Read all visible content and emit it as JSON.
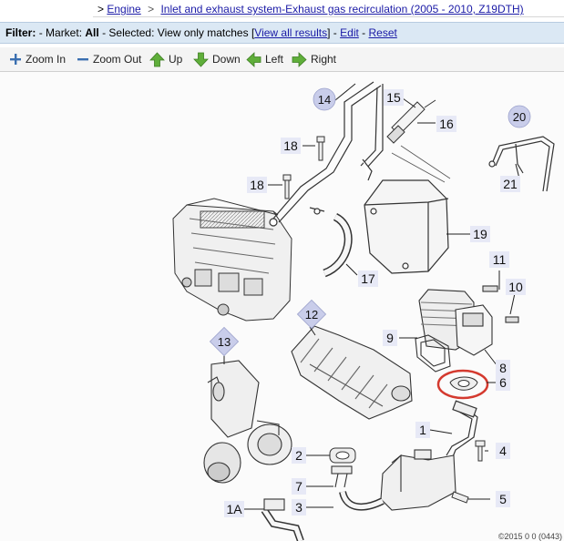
{
  "breadcrumb": {
    "items": [
      {
        "label": ">",
        "link": false
      },
      {
        "label": "Engine",
        "link": true
      },
      {
        "label": ">",
        "link": false
      },
      {
        "label": "Inlet and exhaust system-Exhaust gas recirculation (2005 - 2010, Z19DTH)",
        "link": true
      }
    ]
  },
  "filter": {
    "label": "Filter:",
    "market_prefix": "- Market:",
    "market_value": "All",
    "selected_prefix": "- Selected:",
    "selected_value": "View only matches",
    "view_all": "View all results",
    "edit": "Edit",
    "reset": "Reset"
  },
  "toolbar": {
    "zoom_in": "Zoom In",
    "zoom_out": "Zoom Out",
    "up": "Up",
    "down": "Down",
    "left": "Left",
    "right": "Right"
  },
  "diagram": {
    "callouts": {
      "c1": "1",
      "c1a": "1A",
      "c2": "2",
      "c3": "3",
      "c4": "4",
      "c5": "5",
      "c6": "6",
      "c7": "7",
      "c8": "8",
      "c9": "9",
      "c10": "10",
      "c11": "11",
      "c12": "12",
      "c13": "13",
      "c14": "14",
      "c15": "15",
      "c16": "16",
      "c17": "17",
      "c18a": "18",
      "c18b": "18",
      "c19": "19",
      "c20": "20",
      "c21": "21"
    },
    "highlight_color": "#d43a2f",
    "badge_color": "#c9cdea",
    "copyright": "©2015 0 0 (0443)"
  }
}
